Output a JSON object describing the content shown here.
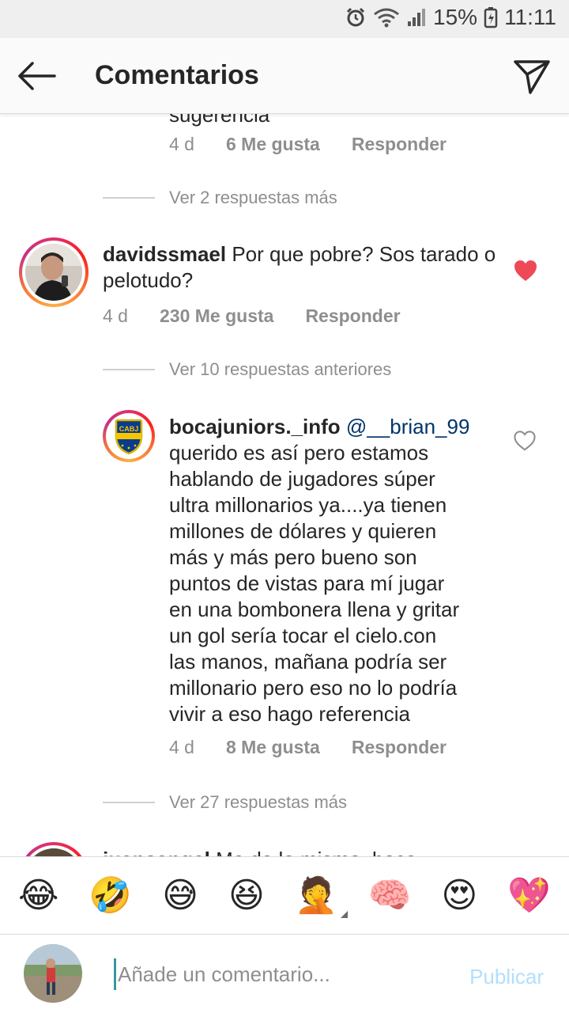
{
  "status_bar": {
    "battery": "15%",
    "time": "11:11"
  },
  "header": {
    "title": "Comentarios"
  },
  "comments": {
    "prev_reply": {
      "cut_text": "sugerencia",
      "time": "4 d",
      "likes": "6 Me gusta",
      "reply": "Responder"
    },
    "view_more_1": "Ver 2 respuestas más",
    "main": {
      "user": "davidssmael",
      "text": "Por que pobre? Sos tarado o pelotudo?",
      "time": "4 d",
      "likes": "230 Me gusta",
      "reply": "Responder",
      "liked": true
    },
    "view_previous": "Ver 10 respuestas anteriores",
    "reply": {
      "user": "bocajuniors._info",
      "mention": "@__brian_99",
      "text": "querido es así pero estamos\nhablando de jugadores súper\nultra millonarios ya....ya tienen\nmillones de dólares y quieren\nmás y más pero bueno son\npuntos de vistas para mí jugar\nen una bombonera llena y gritar\nun gol sería tocar el cielo.con\nlas manos, mañana podría ser\nmillonario pero eso no lo podría\nvivir a eso hago referencia",
      "time": "4 d",
      "likes": "8 Me gusta",
      "reply": "Responder",
      "badge": "CABJ"
    },
    "view_more_2": "Ver 27 respuestas más",
    "next": {
      "user": "juansangel",
      "text": "Me da lo mismo, boca"
    }
  },
  "emoji_bar": [
    "😂",
    "🤣",
    "😅",
    "😆",
    "🤦",
    "🧠",
    "😍",
    "💖"
  ],
  "input": {
    "placeholder": "Añade un comentario...",
    "publish": "Publicar"
  },
  "colors": {
    "heart_liked": "#ed4956",
    "mention": "#003569",
    "publish_disabled": "#b2dffc"
  }
}
